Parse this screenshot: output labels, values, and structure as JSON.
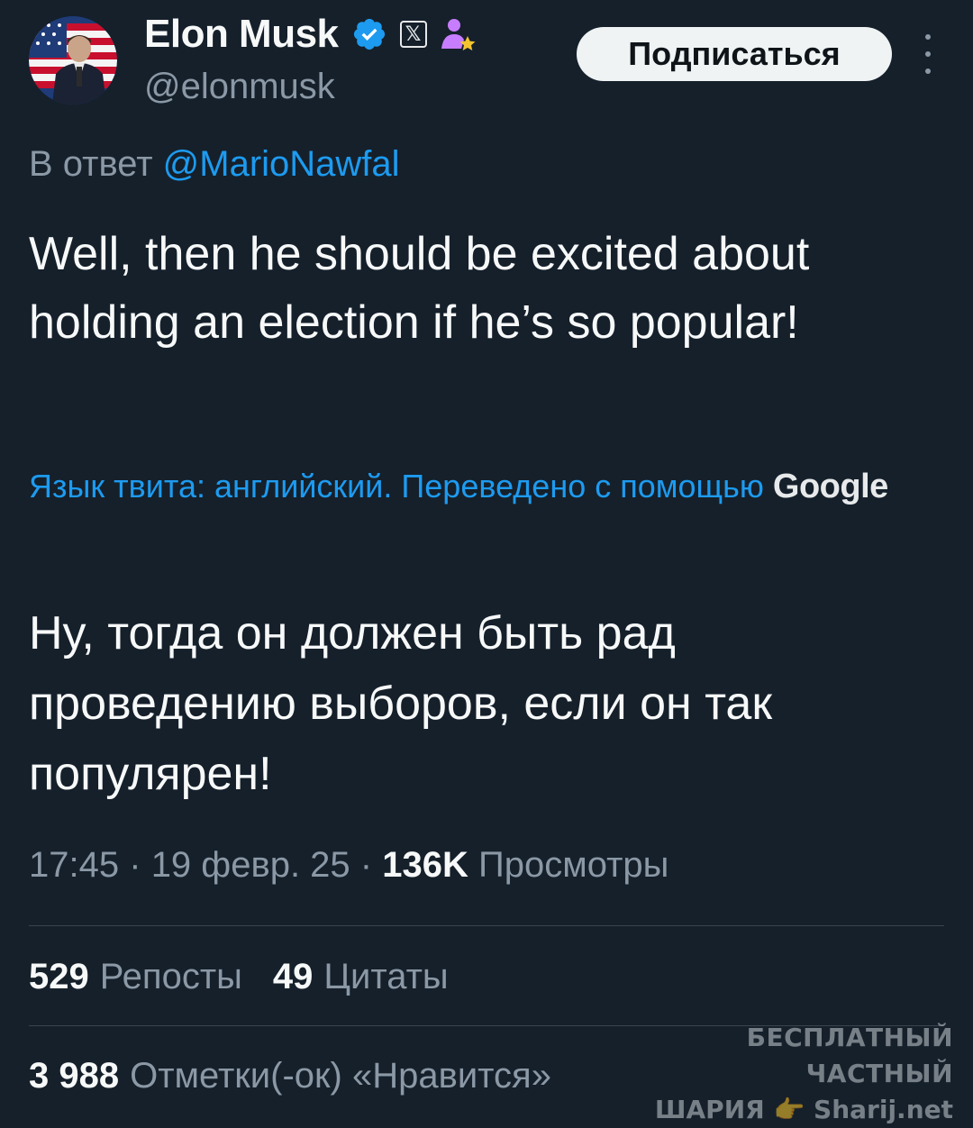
{
  "author": {
    "display_name": "Elon Musk",
    "handle": "@elonmusk",
    "x_badge": "𝕏"
  },
  "header": {
    "subscribe_label": "Подписаться"
  },
  "tweet": {
    "reply_prefix": "В ответ",
    "reply_mention": "@MarioNawfal",
    "text": "Well, then he should be excited about holding an election if he’s so popular!",
    "translation_note": "Язык твита: английский. Переведено с помощью",
    "translation_provider": "Google",
    "translated_text": "Ну, тогда он должен быть рад проведению выборов, если он так популярен!"
  },
  "meta": {
    "time": "17:45",
    "date": "19 февр. 25",
    "separator": "·",
    "views_count": "136K",
    "views_label": "Просмотры"
  },
  "stats": {
    "reposts_count": "529",
    "reposts_label": "Репосты",
    "quotes_count": "49",
    "quotes_label": "Цитаты",
    "likes_count": "3 988",
    "likes_label": "Отметки(-ок) «Нравится»"
  },
  "watermark": {
    "line1": "БЕСПЛАТНЫЙ ЧАСТНЫЙ",
    "line2": "ШАРИЯ 👉 Sharij.net"
  },
  "icons": {
    "verified": "verified-badge-icon",
    "x_logo": "x-logo-icon",
    "user_affiliate": "user-star-icon",
    "more": "more-vertical-icon"
  },
  "colors": {
    "background": "#15202b",
    "accent": "#1d9bf0",
    "text_primary": "#f7f9f9",
    "text_secondary": "#8b98a5",
    "divider": "#38444d",
    "affiliate_badge": "#c77dff"
  }
}
